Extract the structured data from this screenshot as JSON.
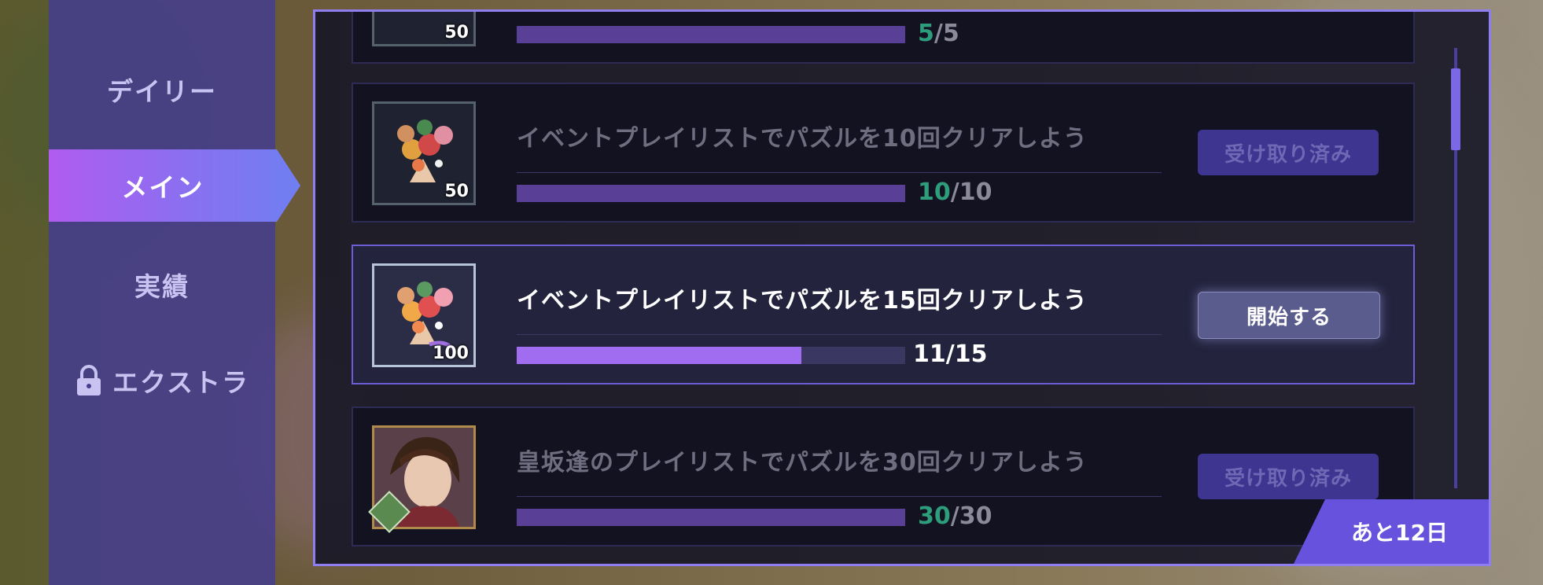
{
  "sidebar": {
    "tabs": [
      {
        "label": "デイリー",
        "active": false
      },
      {
        "label": "メイン",
        "active": true
      },
      {
        "label": "実績",
        "active": false
      },
      {
        "label": "エクストラ",
        "active": false,
        "locked": true
      }
    ]
  },
  "missions": [
    {
      "title": "",
      "reward_count": "50",
      "reward_icon": "bouquet-icon",
      "current": "5",
      "total": "/5",
      "progress": 1.0,
      "button": ""
    },
    {
      "title": "イベントプレイリストでパズルを10回クリアしよう",
      "reward_count": "50",
      "reward_icon": "bouquet-icon",
      "current": "10",
      "total": "/10",
      "progress": 1.0,
      "button": "受け取り済み"
    },
    {
      "title": "イベントプレイリストでパズルを15回クリアしよう",
      "reward_count": "100",
      "reward_icon": "bouquet-icon",
      "current": "11",
      "total": "/15",
      "progress": 0.733,
      "button": "開始する"
    },
    {
      "title": "皇坂逢のプレイリストでパズルを30回クリアしよう",
      "reward_count": "",
      "reward_icon": "character-portrait-icon",
      "current": "30",
      "total": "/30",
      "progress": 1.0,
      "button": "受け取り済み"
    }
  ],
  "remaining": "あと12日",
  "colors": {
    "accent": "#8f7ef0",
    "done": "#2e9d7c",
    "bar_active": "#a06cf0"
  }
}
